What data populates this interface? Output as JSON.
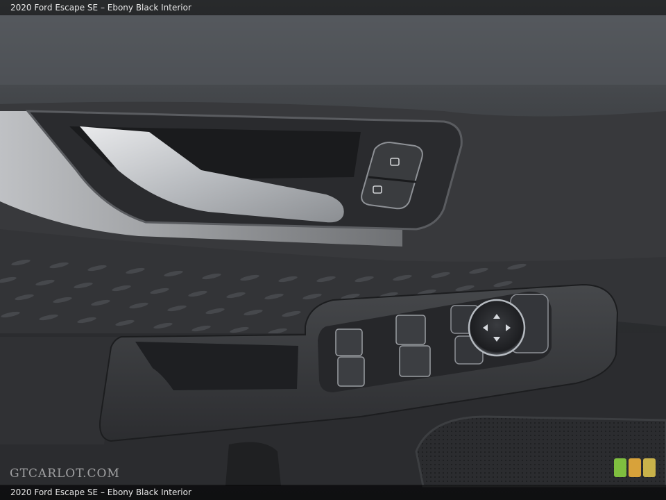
{
  "caption": {
    "top": "2020 Ford Escape SE – Ebony Black Interior",
    "bottom": "2020 Ford Escape SE – Ebony Black Interior"
  },
  "watermark": "GTCARLOT.COM",
  "logo": {
    "colors": [
      "#7fbf3f",
      "#d8a23a",
      "#c9b24a"
    ]
  }
}
